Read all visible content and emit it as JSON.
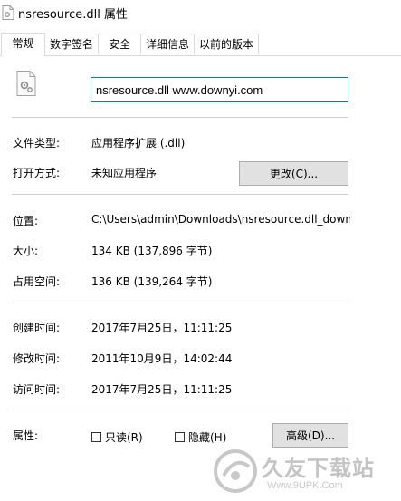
{
  "window": {
    "title": "nsresource.dll 属性"
  },
  "tabs": [
    {
      "label": "常规",
      "active": true
    },
    {
      "label": "数字签名"
    },
    {
      "label": "安全"
    },
    {
      "label": "详细信息"
    },
    {
      "label": "以前的版本"
    }
  ],
  "general": {
    "file_name": "nsresource.dll www.downyi.com",
    "type_label": "文件类型:",
    "type_value": "应用程序扩展 (.dll)",
    "opens_with_label": "打开方式:",
    "opens_with_value": "未知应用程序",
    "change_button": "更改(C)...",
    "location_label": "位置:",
    "location_value": "C:\\Users\\admin\\Downloads\\nsresource.dll_downy",
    "size_label": "大小:",
    "size_value": "134 KB (137,896 字节)",
    "size_on_disk_label": "占用空间:",
    "size_on_disk_value": "136 KB (139,264 字节)",
    "created_label": "创建时间:",
    "created_value": "2017年7月25日，11:11:25",
    "modified_label": "修改时间:",
    "modified_value": "2011年10月9日，14:02:44",
    "accessed_label": "访问时间:",
    "accessed_value": "2017年7月25日，11:11:25",
    "attributes_label": "属性:",
    "readonly_label": "只读(R)",
    "hidden_label": "隐藏(H)",
    "advanced_button": "高级(D)..."
  },
  "watermark": {
    "text": "久友下载站",
    "url": "Www.9UPK.Com"
  },
  "colors": {
    "focus_border": "#0078d7",
    "button_face": "#e1e1e1",
    "separator": "#cfcfcf"
  }
}
